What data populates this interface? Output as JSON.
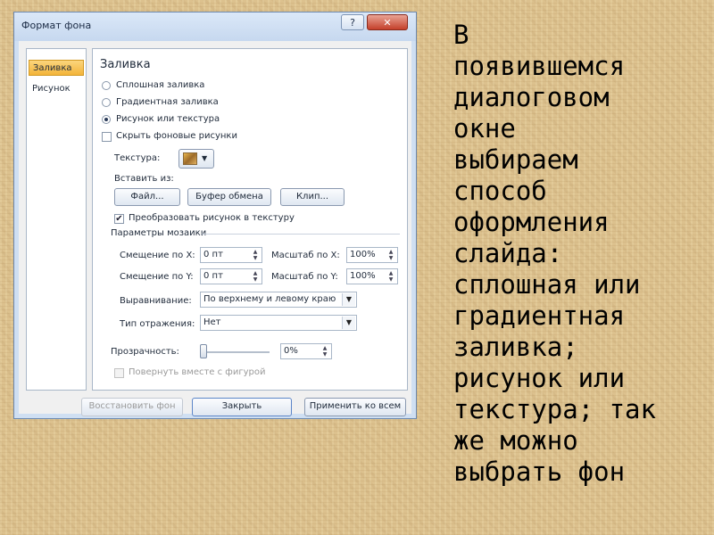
{
  "dialog": {
    "title": "Формат фона",
    "help_label": "?",
    "close_label": "✕",
    "sidebar": [
      {
        "label": "Заливка",
        "selected": true
      },
      {
        "label": "Рисунок",
        "selected": false
      }
    ],
    "section_title": "Заливка",
    "fill_options": [
      {
        "label": "Сплошная заливка",
        "selected": false
      },
      {
        "label": "Градиентная заливка",
        "selected": false
      },
      {
        "label": "Рисунок или текстура",
        "selected": true
      }
    ],
    "hide_background": {
      "label": "Скрыть фоновые рисунки",
      "checked": false
    },
    "texture_label": "Текстура:",
    "insert_from_label": "Вставить из:",
    "insert_buttons": [
      "Файл...",
      "Буфер обмена",
      "Клип..."
    ],
    "convert_to_texture": {
      "label": "Преобразовать рисунок в текстуру",
      "checked": true
    },
    "tiling_title": "Параметры мозаики",
    "offset_x": {
      "label": "Смещение по X:",
      "value": "0 пт"
    },
    "offset_y": {
      "label": "Смещение по Y:",
      "value": "0 пт"
    },
    "scale_x": {
      "label": "Масштаб по X:",
      "value": "100%"
    },
    "scale_y": {
      "label": "Масштаб по Y:",
      "value": "100%"
    },
    "alignment": {
      "label": "Выравнивание:",
      "value": "По верхнему и левому краю"
    },
    "mirror_type": {
      "label": "Тип отражения:",
      "value": "Нет"
    },
    "transparency": {
      "label": "Прозрачность:",
      "value": "0%",
      "level": 0
    },
    "rotate_with_shape": {
      "label": "Повернуть вместе с фигурой",
      "checked": false,
      "enabled": false
    },
    "footer_buttons": {
      "reset": "Восстановить фон",
      "close": "Закрыть",
      "apply_all": "Применить ко всем"
    }
  },
  "narrative_lines": [
    "В",
    "появившемся",
    "диалоговом",
    "окне",
    "выбираем",
    "способ",
    "оформления",
    "слайда:",
    "сплошная или",
    "градиентная",
    "заливка;",
    "рисунок или",
    "текстура; так",
    "же можно",
    "выбрать фон"
  ],
  "colors": {
    "background": "#dcc18e",
    "dialog_frame": "#cfdff2",
    "selected_tab": "#f3b43a",
    "close_button": "#c4402b"
  },
  "icons": [
    "help-icon",
    "close-icon",
    "texture-thumbnail-icon",
    "dropdown-arrow-icon",
    "spin-arrows-icon"
  ]
}
